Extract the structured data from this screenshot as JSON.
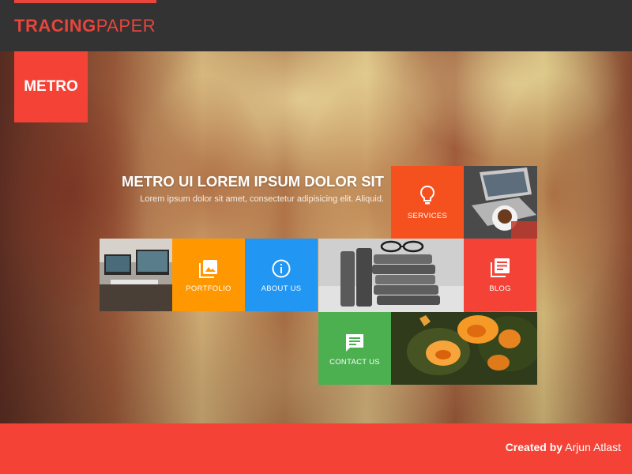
{
  "header": {
    "brand_part1": "TRACING",
    "brand_part2": "PAPER",
    "accent_color": "#e8453c"
  },
  "badge": {
    "label": "METRO"
  },
  "hero": {
    "title": "METRO UI LOREM IPSUM DOLOR SIT",
    "subtitle": "Lorem ipsum dolor sit amet, consectetur adipisicing elit. Aliquid."
  },
  "tiles": {
    "services": {
      "label": "SERVICES",
      "icon": "lightbulb-icon",
      "color": "#f4511e"
    },
    "portfolio": {
      "label": "PORTFOLIO",
      "icon": "image-gallery-icon",
      "color": "#ff9800"
    },
    "about": {
      "label": "ABOUT US",
      "icon": "info-icon",
      "color": "#2196f3"
    },
    "blog": {
      "label": "BLOG",
      "icon": "article-icon",
      "color": "#f44336"
    },
    "contact": {
      "label": "CONTACT US",
      "icon": "chat-icon",
      "color": "#4caf50"
    }
  },
  "photos": [
    "laptop-coffee-photo",
    "desk-computers-photo",
    "books-glasses-photo",
    "orange-flowers-photo"
  ],
  "footer": {
    "credit_prefix": "Created by",
    "credit_name": "Arjun Atlast",
    "color": "#f44336"
  }
}
